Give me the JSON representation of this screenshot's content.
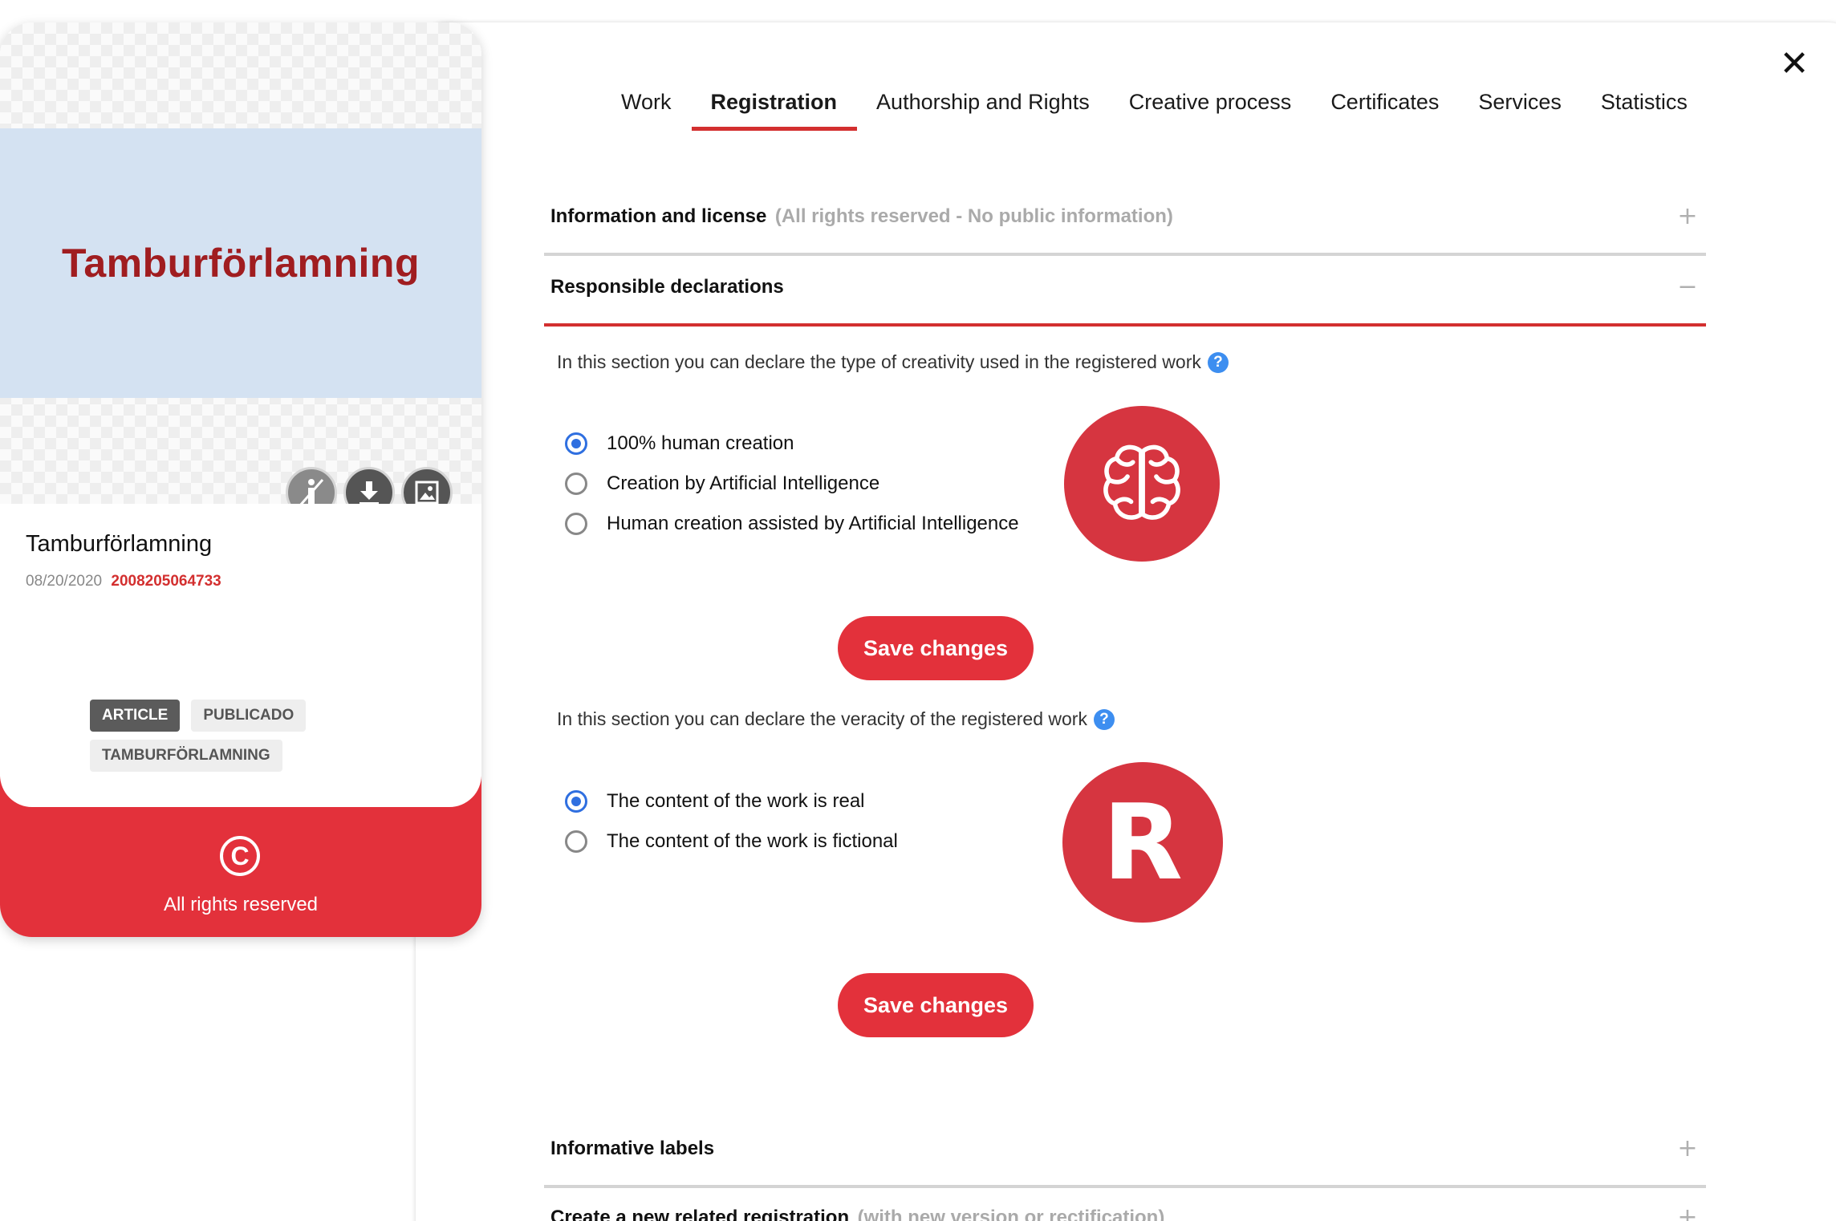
{
  "nav": {
    "close_label": "✕",
    "tabs": [
      {
        "label": "Work"
      },
      {
        "label": "Registration"
      },
      {
        "label": "Authorship and Rights"
      },
      {
        "label": "Creative process"
      },
      {
        "label": "Certificates"
      },
      {
        "label": "Services"
      },
      {
        "label": "Statistics"
      }
    ],
    "active_tab": "Registration"
  },
  "accordion": {
    "info_license": {
      "title": "Information and license",
      "subtitle": "(All rights reserved - No public information)",
      "toggle": "+"
    },
    "responsible": {
      "title": "Responsible declarations",
      "toggle": "−"
    },
    "informative": {
      "title": "Informative labels",
      "toggle": "+"
    },
    "related": {
      "title": "Create a new related registration",
      "subtitle": "(with new version or rectification)",
      "toggle": "+"
    }
  },
  "creativity": {
    "intro": "In this section you can declare the type of creativity used in the registered work",
    "help": "?",
    "options": [
      {
        "label": "100% human creation",
        "checked": true
      },
      {
        "label": "Creation by Artificial Intelligence",
        "checked": false
      },
      {
        "label": "Human creation assisted by Artificial Intelligence",
        "checked": false
      }
    ],
    "icon": "brain-icon",
    "save_label": "Save changes"
  },
  "veracity": {
    "intro": "In this section you can declare the veracity of the registered work",
    "help": "?",
    "options": [
      {
        "label": "The content of the work is real",
        "checked": true
      },
      {
        "label": "The content of the work is fictional",
        "checked": false
      }
    ],
    "icon_letter": "R",
    "save_label": "Save changes"
  },
  "card": {
    "banner_text": "Tamburförlamning",
    "title": "Tamburförlamning",
    "date": "08/20/2020",
    "registry_id": "2008205064733",
    "tags": [
      "ARTICLE",
      "PUBLICADO",
      "TAMBURFÖRLAMNING"
    ],
    "rights_symbol": "C",
    "rights_label": "All rights reserved",
    "actions": [
      "info-disabled-icon",
      "download-icon",
      "image-icon"
    ]
  },
  "colors": {
    "accent": "#e3313b",
    "tab_underline": "#d32f2f",
    "radio_checked": "#2f6fe0",
    "help_icon": "#3d8ef0",
    "banner_bg": "#d4e2f2",
    "banner_text": "#a01d20"
  }
}
